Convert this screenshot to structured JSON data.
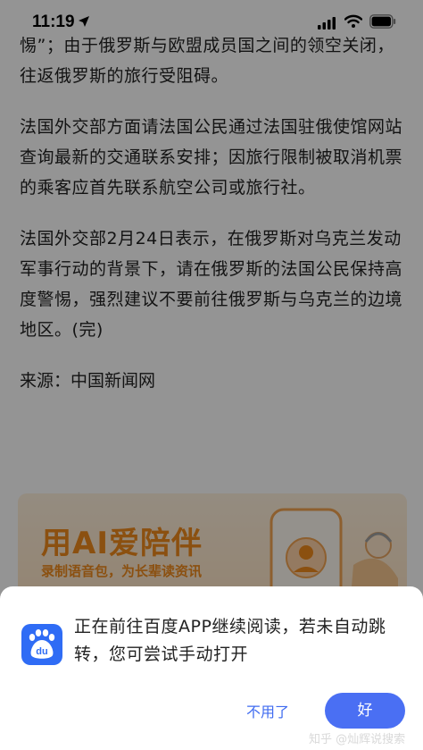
{
  "status": {
    "time": "11:19"
  },
  "article": {
    "paragraphs": [
      "惕”；由于俄罗斯与欧盟成员国之间的领空关闭，往返俄罗斯的旅行受阻碍。",
      "法国外交部方面请法国公民通过法国驻俄使馆网站查询最新的交通联系安排；因旅行限制被取消机票的乘客应首先联系航空公司或旅行社。",
      "法国外交部2月24日表示，在俄罗斯对乌克兰发动军事行动的背景下，请在俄罗斯的法国公民保持高度警惕，强烈建议不要前往俄罗斯与乌克兰的边境地区。(完)"
    ],
    "source": "来源：中国新闻网"
  },
  "ad": {
    "title": "用AI爱陪伴",
    "subtitle": "录制语音包，为长辈读资讯"
  },
  "sheet": {
    "icon_name": "baidu-app-icon",
    "icon_text": "du",
    "message": "正在前往百度APP继续阅读，若未自动跳转，您可尝试手动打开",
    "cancel_label": "不用了",
    "ok_label": "好"
  },
  "watermark": "知乎 @灿辉说搜索",
  "colors": {
    "accent": "#4a6ff3",
    "cancel_text": "#3f6bf0",
    "ad_orange": "#f08a1c"
  }
}
